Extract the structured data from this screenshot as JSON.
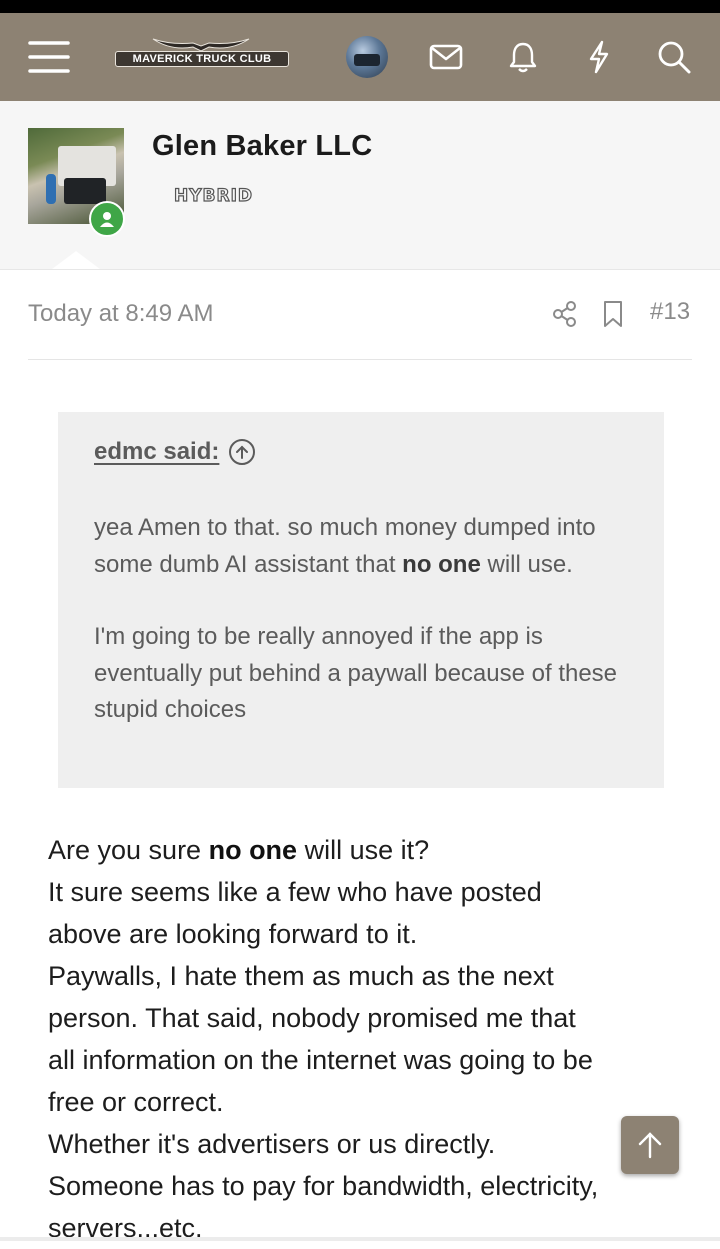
{
  "header": {
    "menu_icon": "hamburger-menu-icon",
    "logo_text": "MAVERICK TRUCK CLUB",
    "icons": [
      "avatar",
      "mail-icon",
      "bell-icon",
      "bolt-icon",
      "search-icon"
    ],
    "brand_color": "#8d8273"
  },
  "profile": {
    "username": "Glen Baker LLC",
    "user_title": "HYBRID",
    "online_badge_color": "#3fa647"
  },
  "post": {
    "time": "Today at 8:49 AM",
    "number": "#13",
    "quote": {
      "author": "edmc said:",
      "line1_a": "yea Amen to that. so much money dumped into some dumb AI assistant that ",
      "line1_bold": "no one",
      "line1_b": " will use.",
      "line2": "I'm going to be really annoyed if the app is eventually put behind a paywall because of these stupid choices"
    },
    "body": {
      "l1_a": "Are you sure ",
      "l1_bold": "no one",
      "l1_b": " will use it?",
      "l2": "It sure seems like a few who have posted",
      "l3": "above are looking forward to it.",
      "l4": "Paywalls, I hate them as much as the next",
      "l5": "person. That said, nobody promised me that",
      "l6": "all information on the internet was going to be",
      "l7": "free or correct.",
      "l8": "Whether it's advertisers or us directly.",
      "l9": "Someone has to pay for bandwidth, electricity,",
      "l10": "servers...etc."
    }
  }
}
